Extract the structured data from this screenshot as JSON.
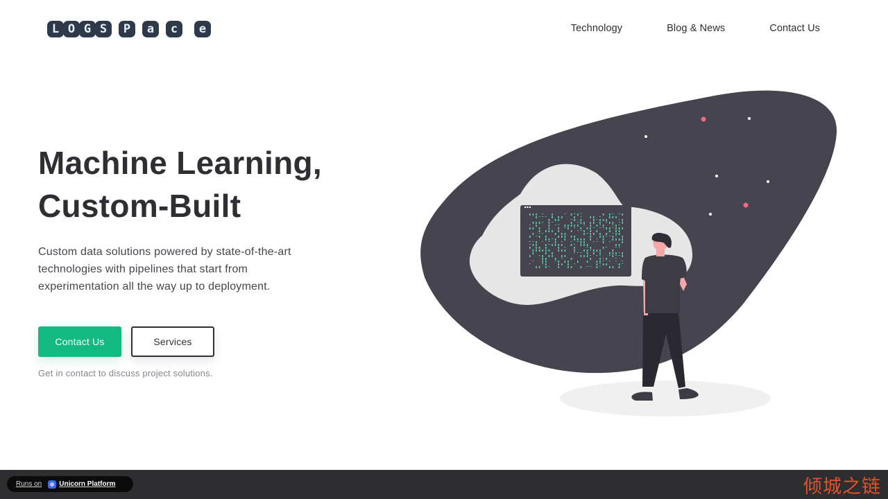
{
  "header": {
    "logo_tiles": [
      "L",
      "O",
      "G",
      "S",
      "P",
      "a",
      "c",
      "e"
    ],
    "logo_text": "LOGSPace",
    "nav": [
      {
        "label": "Technology"
      },
      {
        "label": "Blog & News"
      },
      {
        "label": "Contact Us"
      }
    ]
  },
  "hero": {
    "title_line1": "Machine Learning,",
    "title_line2": "Custom-Built",
    "subtitle": "Custom data solutions powered by state-of-the-art technologies with pipelines that start from experimentation all the way up to deployment.",
    "primary_button": "Contact Us",
    "secondary_button": "Services",
    "note": "Get in contact to discuss project solutions."
  },
  "illustration": {
    "description": "Person looking at a terminal screen with matrix-style code",
    "colors": {
      "blob": "#46454f",
      "inner_blob": "#e6e6e6",
      "screen": "#46454f",
      "code": "#5ed3a8",
      "accent_dot": "#f06b82",
      "skin": "#f4a8a8",
      "shirt": "#3d3c44",
      "pants": "#2a292f",
      "ground": "#f0f0f0"
    }
  },
  "footer": {
    "badge_prefix": "Runs on",
    "badge_brand": "Unicorn Platform",
    "watermark": "倾城之链"
  },
  "colors": {
    "primary": "#12b981",
    "text": "#2f2f33",
    "footer_bg": "#2e2e31"
  }
}
